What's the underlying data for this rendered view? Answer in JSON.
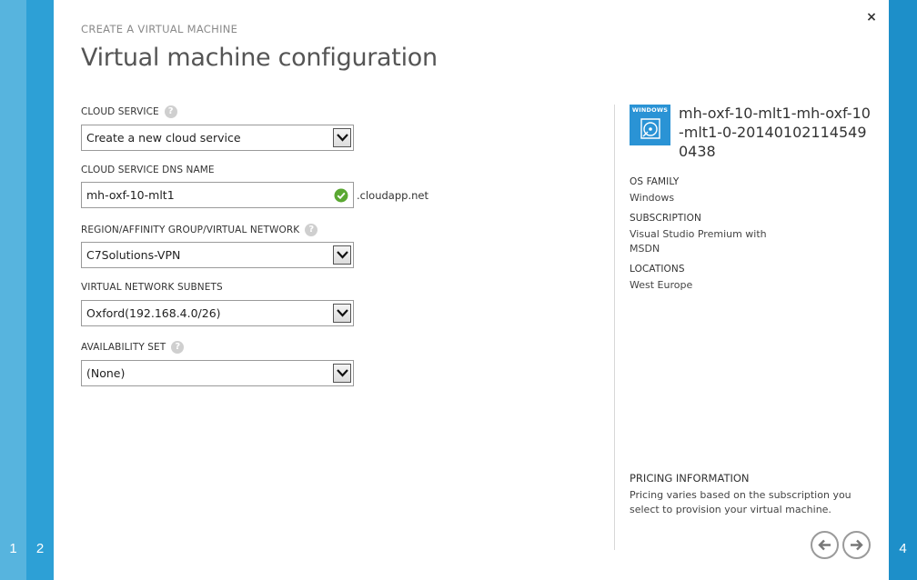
{
  "wizard": {
    "caption": "CREATE A VIRTUAL MACHINE",
    "title": "Virtual machine configuration",
    "steps_left": [
      "1",
      "2"
    ],
    "step_right": "4",
    "close_glyph": "×"
  },
  "form": {
    "cloud_service": {
      "label": "CLOUD SERVICE",
      "value": "Create a new cloud service"
    },
    "dns_name": {
      "label": "CLOUD SERVICE DNS NAME",
      "value": "mh-oxf-10-mlt1",
      "suffix": ".cloudapp.net"
    },
    "region": {
      "label": "REGION/AFFINITY GROUP/VIRTUAL NETWORK",
      "value": "C7Solutions-VPN"
    },
    "subnets": {
      "label": "VIRTUAL NETWORK SUBNETS",
      "value": "Oxford(192.168.4.0/26)"
    },
    "availability_set": {
      "label": "AVAILABILITY SET",
      "value": "(None)"
    },
    "help_glyph": "?"
  },
  "summary": {
    "os_tile_label": "WINDOWS",
    "vm_name": "mh-oxf-10-mlt1-mh-oxf-10-mlt1-0-201401021145490438",
    "os_family_key": "OS FAMILY",
    "os_family_value": "Windows",
    "subscription_key": "SUBSCRIPTION",
    "subscription_value": "Visual Studio Premium with MSDN",
    "locations_key": "LOCATIONS",
    "locations_value": "West Europe",
    "pricing_title": "PRICING INFORMATION",
    "pricing_text": "Pricing varies based on the subscription you select to provision your virtual machine."
  },
  "colors": {
    "rail_light": "#57b4de",
    "rail_mid": "#2da0d6",
    "rail_dark": "#1d8fc9",
    "tile": "#2a93d5",
    "valid_check": "#5aa832"
  },
  "icons": {
    "close": "close-icon",
    "help": "help-icon",
    "dropdown": "chevron-down-icon",
    "valid": "check-circle-icon",
    "os": "windows-disc-icon",
    "back": "arrow-left-icon",
    "next": "arrow-right-icon"
  }
}
